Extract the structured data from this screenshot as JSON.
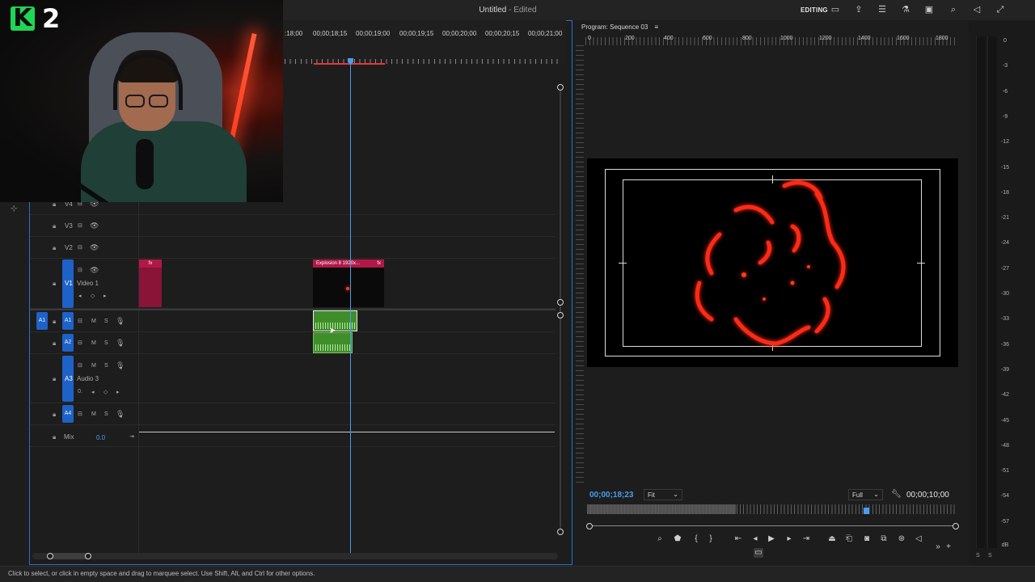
{
  "topbar": {
    "title": "Untitled",
    "title_suffix": " - Edited",
    "workspace_label": "EDITING"
  },
  "webcam": {
    "badge_letter": "K",
    "badge_number": "2"
  },
  "timeline": {
    "ruler_labels": [
      ":18;00",
      "00;00;18;15",
      "00;00;19;00",
      "00;00;19;15",
      "00;00;20;00",
      "00;00;20;15",
      "00;00;21;00"
    ],
    "tracks": [
      {
        "id": "V4",
        "name": ""
      },
      {
        "id": "V3",
        "name": ""
      },
      {
        "id": "V2",
        "name": ""
      },
      {
        "id": "V1",
        "name": "Video 1"
      },
      {
        "id": "A1",
        "name": ""
      },
      {
        "id": "A2",
        "name": ""
      },
      {
        "id": "A3",
        "name": "Audio 3"
      },
      {
        "id": "A4",
        "name": ""
      }
    ],
    "source_patch_a1": "A1",
    "btn_m": "M",
    "btn_s": "S",
    "mix_label": "Mix",
    "mix_value": "0.0",
    "audio3_value": "0.",
    "fx_label": "fx",
    "clip_explosion": "Explosion 8 1920x..."
  },
  "program": {
    "title": "Program: Sequence 03",
    "menu_icon": "≡",
    "ruler_labels": [
      "0",
      "200",
      "400",
      "600",
      "800",
      "1000",
      "1200",
      "1400",
      "1600",
      "1800"
    ],
    "timecode_current": "00;00;18;23",
    "timecode_duration": "00;00;10;00",
    "zoom_value": "Fit",
    "resolution_value": "Full"
  },
  "meters": {
    "labels": [
      "0",
      "-3",
      "-6",
      "-9",
      "-12",
      "-15",
      "-18",
      "-21",
      "-24",
      "-27",
      "-30",
      "-33",
      "-36",
      "-39",
      "-42",
      "-45",
      "-48",
      "-51",
      "-54",
      "-57",
      "dB"
    ],
    "solo_left": "S",
    "solo_right": "S"
  },
  "status": {
    "text": "Click to select, or click in empty space and drag to marquee select. Use Shift, Alt, and Ctrl for other options."
  },
  "colors": {
    "accent": "#2a6fd1",
    "playhead": "#4a9cf0",
    "video_clip": "#b01848",
    "audio_clip": "#3e8f2a"
  }
}
